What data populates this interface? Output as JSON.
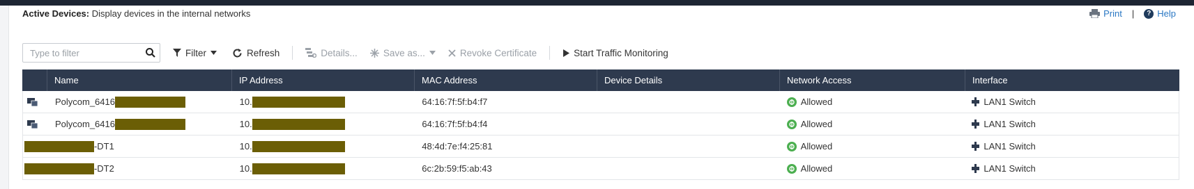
{
  "header": {
    "title_bold": "Active Devices:",
    "title_rest": " Display devices in the internal networks",
    "print_label": "Print",
    "separator": "|",
    "help_label": "Help"
  },
  "toolbar": {
    "filter_placeholder": "Type to filter",
    "filter_label": "Filter",
    "refresh_label": "Refresh",
    "details_label": "Details...",
    "save_as_label": "Save as...",
    "revoke_label": "Revoke Certificate",
    "start_monitor_label": "Start Traffic Monitoring"
  },
  "table": {
    "columns": [
      "Name",
      "IP Address",
      "MAC Address",
      "Device Details",
      "Network Access",
      "Interface"
    ],
    "rows": [
      {
        "name_prefix": "Polycom_6416",
        "name_suffix": "",
        "ip_prefix": "10.",
        "mac": "64:16:7f:5f:b4:f7",
        "details": "",
        "access": "Allowed",
        "interface": "LAN1 Switch",
        "device_icon": "phone-device-icon"
      },
      {
        "name_prefix": "Polycom_6416",
        "name_suffix": "",
        "ip_prefix": "10.",
        "mac": "64:16:7f:5f:b4:f4",
        "details": "",
        "access": "Allowed",
        "interface": "LAN1 Switch",
        "device_icon": "phone-device-icon"
      },
      {
        "name_prefix": "",
        "name_suffix": "-DT1",
        "ip_prefix": "10.",
        "mac": "48:4d:7e:f4:25:81",
        "details": "",
        "access": "Allowed",
        "interface": "LAN1 Switch",
        "device_icon": ""
      },
      {
        "name_prefix": "",
        "name_suffix": "-DT2",
        "ip_prefix": "10.",
        "mac": "6c:2b:59:f5:ab:43",
        "details": "",
        "access": "Allowed",
        "interface": "LAN1 Switch",
        "device_icon": ""
      }
    ]
  },
  "colors": {
    "header_bg": "#2e3a4e",
    "link": "#2b78c4",
    "redaction": "#6b5e05",
    "allowed": "#4caf50"
  }
}
